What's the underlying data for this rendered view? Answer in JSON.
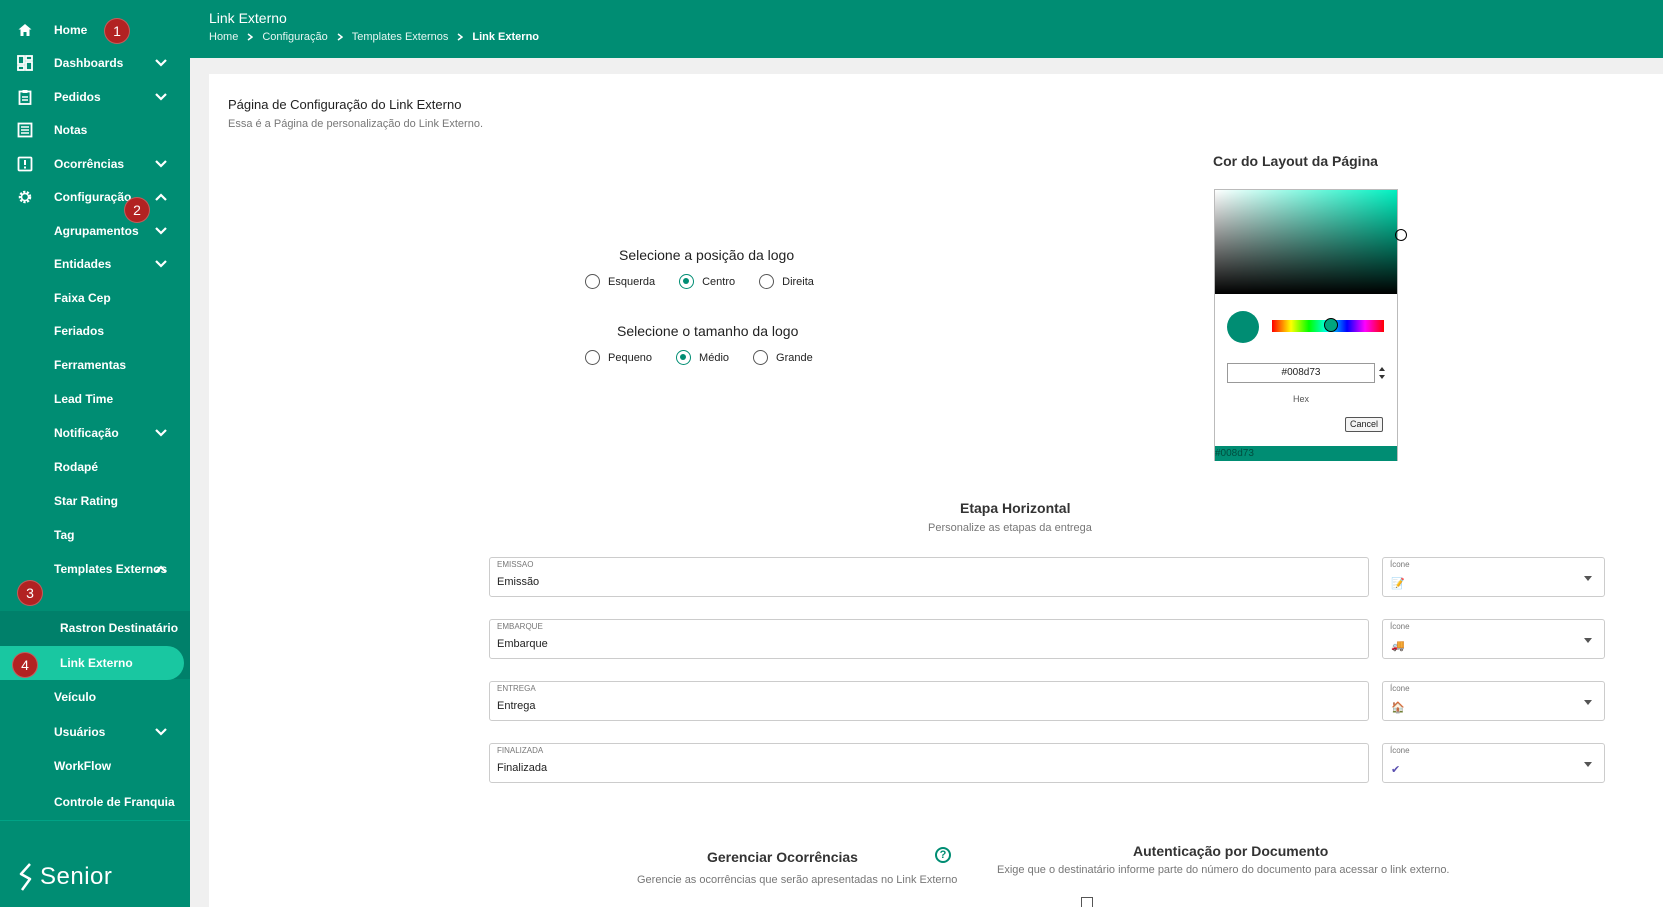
{
  "sidebar": {
    "items": [
      {
        "label": "Home",
        "icon": "home-icon",
        "chevron": ""
      },
      {
        "label": "Dashboards",
        "icon": "dashboard-icon",
        "chevron": "down"
      },
      {
        "label": "Pedidos",
        "icon": "clipboard-icon",
        "chevron": "down"
      },
      {
        "label": "Notas",
        "icon": "notes-icon",
        "chevron": ""
      },
      {
        "label": "Ocorrências",
        "icon": "alert-icon",
        "chevron": "down"
      },
      {
        "label": "Configuração",
        "icon": "gear-icon",
        "chevron": "up"
      },
      {
        "label": "Agrupamentos",
        "chevron": "down"
      },
      {
        "label": "Entidades",
        "chevron": "down"
      },
      {
        "label": "Faixa Cep",
        "chevron": ""
      },
      {
        "label": "Feriados",
        "chevron": ""
      },
      {
        "label": "Ferramentas",
        "chevron": ""
      },
      {
        "label": "Lead Time",
        "chevron": ""
      },
      {
        "label": "Notificação",
        "chevron": "down"
      },
      {
        "label": "Rodapé",
        "chevron": ""
      },
      {
        "label": "Star Rating",
        "chevron": ""
      },
      {
        "label": "Tag",
        "chevron": ""
      },
      {
        "label": "Templates Externos",
        "chevron": "up"
      },
      {
        "label": "Rastron Destinatário",
        "chevron": ""
      },
      {
        "label": "Link Externo",
        "chevron": ""
      },
      {
        "label": "Veículo",
        "chevron": ""
      },
      {
        "label": "Usuários",
        "chevron": "down"
      },
      {
        "label": "WorkFlow",
        "chevron": ""
      },
      {
        "label": "Controle de Franquia",
        "chevron": ""
      }
    ],
    "badges": [
      "1",
      "2",
      "3",
      "4"
    ],
    "brand": "Senior"
  },
  "header": {
    "title": "Link Externo",
    "breadcrumb": [
      "Home",
      "Configuração",
      "Templates Externos",
      "Link Externo"
    ]
  },
  "page": {
    "heading": "Página de Configuração do Link Externo",
    "subheading": "Essa é a Página de personalização do Link Externo."
  },
  "logo_position": {
    "title": "Selecione a posição da logo",
    "options": [
      "Esquerda",
      "Centro",
      "Direita"
    ],
    "selected": "Centro"
  },
  "logo_size": {
    "title": "Selecione o tamanho da logo",
    "options": [
      "Pequeno",
      "Médio",
      "Grande"
    ],
    "selected": "Médio"
  },
  "color_picker": {
    "title": "Cor do Layout da Página",
    "hex_value": "#008d73",
    "hex_label": "Hex",
    "cancel_label": "Cancel",
    "footer_value": "#008d73",
    "color": "#008d73"
  },
  "etapa": {
    "title": "Etapa Horizontal",
    "subtitle": "Personalize as etapas da entrega",
    "icon_label": "Ícone",
    "steps": [
      {
        "label": "EMISSAO",
        "value": "Emissão",
        "icon_glyph": "📝"
      },
      {
        "label": "EMBARQUE",
        "value": "Embarque",
        "icon_glyph": "🚚"
      },
      {
        "label": "ENTREGA",
        "value": "Entrega",
        "icon_glyph": "🏠"
      },
      {
        "label": "FINALIZADA",
        "value": "Finalizada",
        "icon_glyph": "✔"
      }
    ]
  },
  "ocorrencias": {
    "title": "Gerenciar Ocorrências",
    "subtitle": "Gerencie as ocorrências que serão apresentadas no Link Externo",
    "help_glyph": "?"
  },
  "autenticacao": {
    "title": "Autenticação por Documento",
    "subtitle": "Exige que o destinatário informe parte do número do documento para acessar o link externo."
  },
  "colors": {
    "brand": "#008d73",
    "active_item": "#19c7a1",
    "badge": "#b22222"
  }
}
